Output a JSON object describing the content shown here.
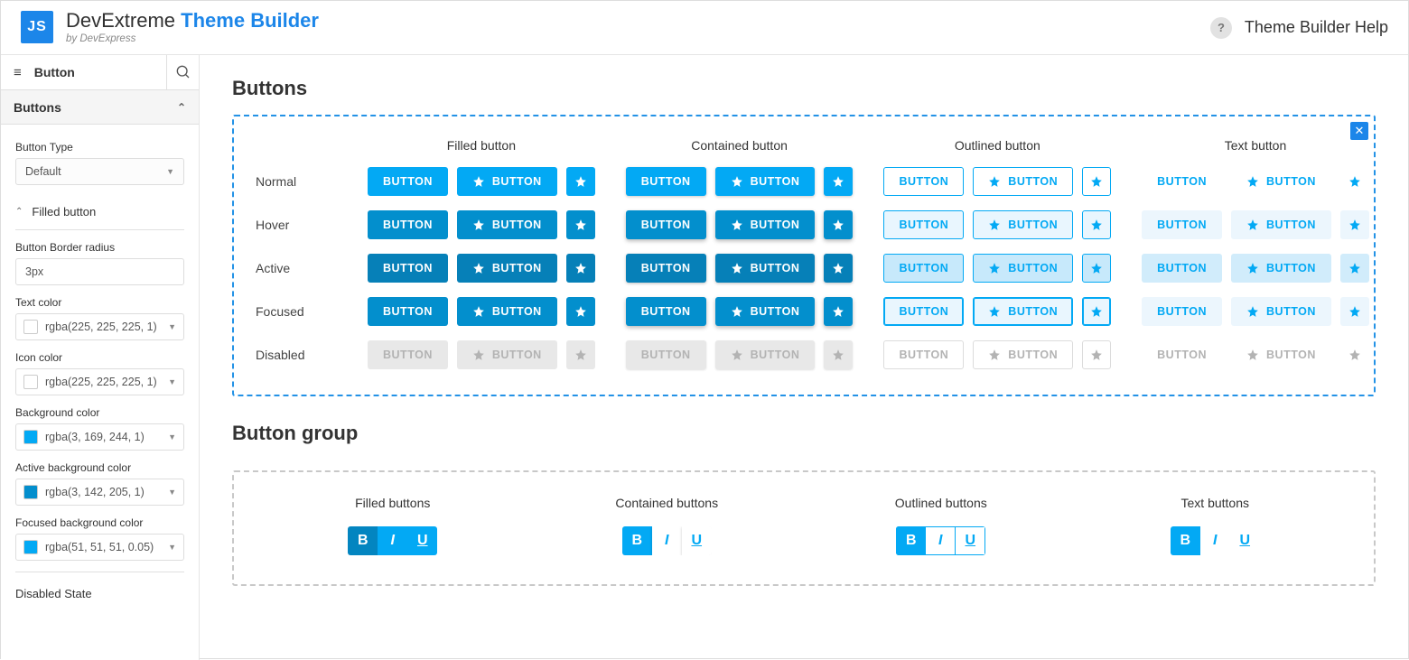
{
  "brand": {
    "logo": "JS",
    "name1": "DevExtreme",
    "name2": "Theme Builder",
    "sub": "by DevExpress"
  },
  "header": {
    "help_label": "Theme Builder Help",
    "help_icon": "?"
  },
  "sidebar": {
    "breadcrumb": "Button",
    "accordion_title": "Buttons",
    "button_type": {
      "label": "Button Type",
      "value": "Default"
    },
    "sub_section": "Filled button",
    "border_radius": {
      "label": "Button Border radius",
      "value": "3px"
    },
    "text_color": {
      "label": "Text color",
      "value": "rgba(225, 225, 225, 1)",
      "swatch": "#ffffff"
    },
    "icon_color": {
      "label": "Icon color",
      "value": "rgba(225, 225, 225, 1)",
      "swatch": "#ffffff"
    },
    "bg_color": {
      "label": "Background color",
      "value": "rgba(3, 169, 244, 1)",
      "swatch": "#03a9f4"
    },
    "active_bg": {
      "label": "Active background color",
      "value": "rgba(3, 142, 205, 1)",
      "swatch": "#038ecd"
    },
    "focused_bg": {
      "label": "Focused background color",
      "value": "rgba(51, 51, 51, 0.05)",
      "swatch": "#03a9f4"
    },
    "disabled_section": "Disabled State"
  },
  "main": {
    "buttons_title": "Buttons",
    "col_heads": [
      "Filled button",
      "Contained button",
      "Outlined button",
      "Text button"
    ],
    "row_labels": [
      "Normal",
      "Hover",
      "Active",
      "Focused",
      "Disabled"
    ],
    "btn_text": "BUTTON",
    "group_title": "Button group",
    "group_heads": [
      "Filled buttons",
      "Contained buttons",
      "Outlined buttons",
      "Text buttons"
    ],
    "group_letters": {
      "b": "B",
      "i": "I",
      "u": "U"
    }
  }
}
